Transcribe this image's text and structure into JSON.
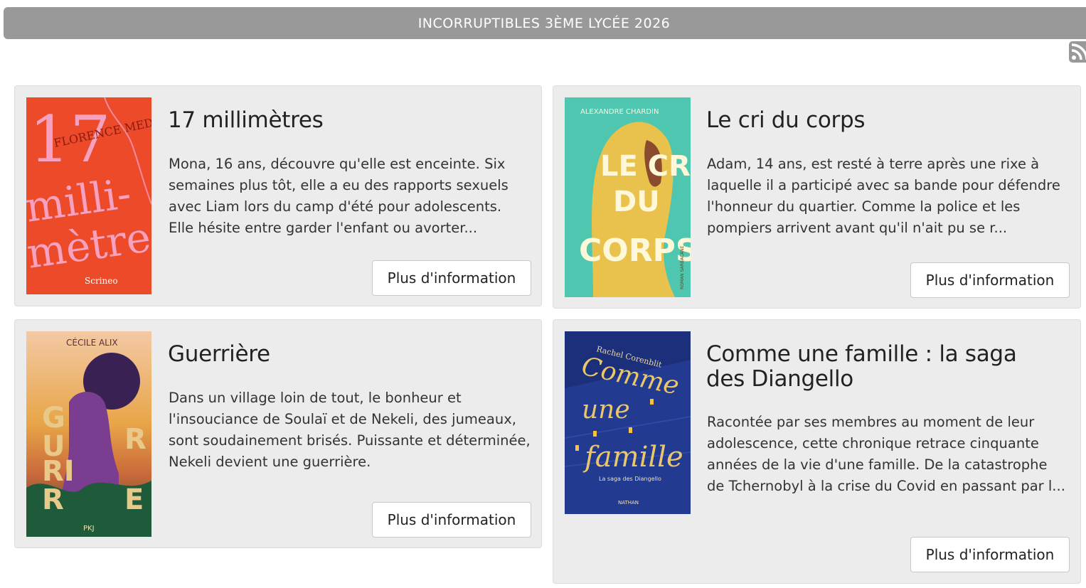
{
  "header": {
    "title": "INCORRUPTIBLES 3ÈME LYCÉE 2026"
  },
  "icons": {
    "feed": "rss-icon"
  },
  "colors": {
    "header_bg": "#999999",
    "card_bg": "#ececec",
    "button_bg": "#ffffff"
  },
  "books": [
    {
      "title": "17 millimètres",
      "description": "Mona, 16 ans, découvre qu'elle est enceinte. Six semaines plus tôt, elle a eu des rapports sexuels avec Liam lors du camp d'été pour adolescents. Elle hésite entre garder l'enfant ou avorter...",
      "button": "Plus d'information",
      "cover": {
        "author": "FLORENCE MEDINA",
        "number": "17",
        "word1": "milli-",
        "word2": "mètres",
        "publisher": "Scrineo"
      }
    },
    {
      "title": "Le cri du corps",
      "description": "Adam, 14 ans, est resté à terre après une rixe à laquelle il a participé avec sa bande pour défendre l'honneur du quartier. Comme la police et les pompiers arrivent avant qu'il n'ait pu se r...",
      "button": "Plus d'information",
      "cover": {
        "author": "ALEXANDRE CHARDIN",
        "line1": "LE CRI",
        "line2": "DU",
        "line3": "CORPS",
        "spine": "ROMAN SARBACANE"
      }
    },
    {
      "title": "Guerrière",
      "description": "Dans un village loin de tout, le bonheur et l'insouciance de Soulaï et de Nekeli, des jumeaux, sont soudainement brisés. Puissante et déterminée, Nekeli devient une guerrière.",
      "button": "Plus d'information",
      "cover": {
        "author": "CÉCILE ALIX",
        "publisher": "PKJ"
      }
    },
    {
      "title": "Comme une famille : la saga des Diangello",
      "description": "Racontée par ses membres au moment de leur adolescence, cette chronique retrace cinquante années de la vie d'une famille. De la catastrophe de Tchernobyl à la crise du Covid en passant par l...",
      "button": "Plus d'information",
      "cover": {
        "author": "Rachel Corenblit",
        "line1": "Comme",
        "line2": "une",
        "line3": "famille",
        "subtitle": "La saga des Diangello",
        "publisher": "NATHAN"
      }
    }
  ]
}
